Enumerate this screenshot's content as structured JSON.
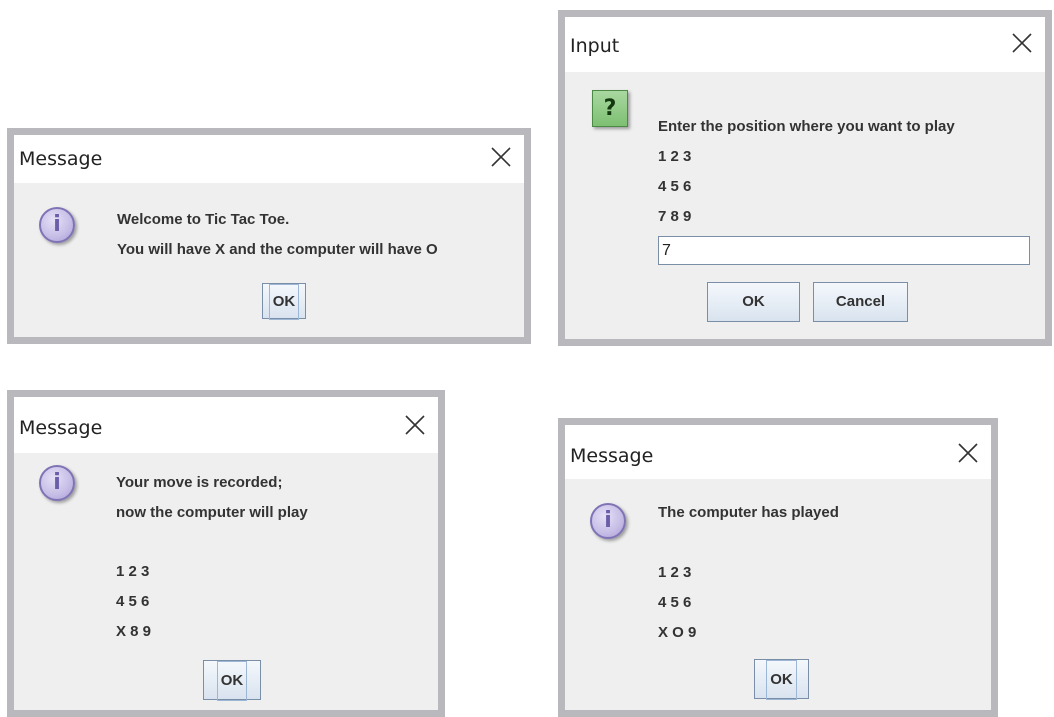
{
  "dialogs": {
    "welcome": {
      "title": "Message",
      "icon": "info-icon",
      "icon_glyph": "i",
      "lines": [
        "Welcome to Tic Tac Toe.",
        "You will have X and the computer will have O"
      ],
      "ok_label": "OK"
    },
    "input": {
      "title": "Input",
      "icon": "question-icon",
      "icon_glyph": "?",
      "prompt": "Enter the position where you want to play",
      "board": [
        "1 2 3",
        "4 5 6",
        "7 8 9"
      ],
      "field_value": "7",
      "ok_label": "OK",
      "cancel_label": "Cancel"
    },
    "recorded": {
      "title": "Message",
      "icon": "info-icon",
      "icon_glyph": "i",
      "lines": [
        "Your move is recorded;",
        "now the computer will play"
      ],
      "board": [
        "1 2 3",
        "4 5 6",
        "X 8 9"
      ],
      "ok_label": "OK"
    },
    "computer": {
      "title": "Message",
      "icon": "info-icon",
      "icon_glyph": "i",
      "lines": [
        "The computer has played"
      ],
      "board": [
        "1 2 3",
        "4 5 6",
        "X O 9"
      ],
      "ok_label": "OK"
    }
  },
  "colors": {
    "frame": "#b9b9bd",
    "body": "#efefef",
    "titlebar": "#ffffff",
    "info_icon": "#c6bde6",
    "question_icon": "#8ecb84"
  }
}
